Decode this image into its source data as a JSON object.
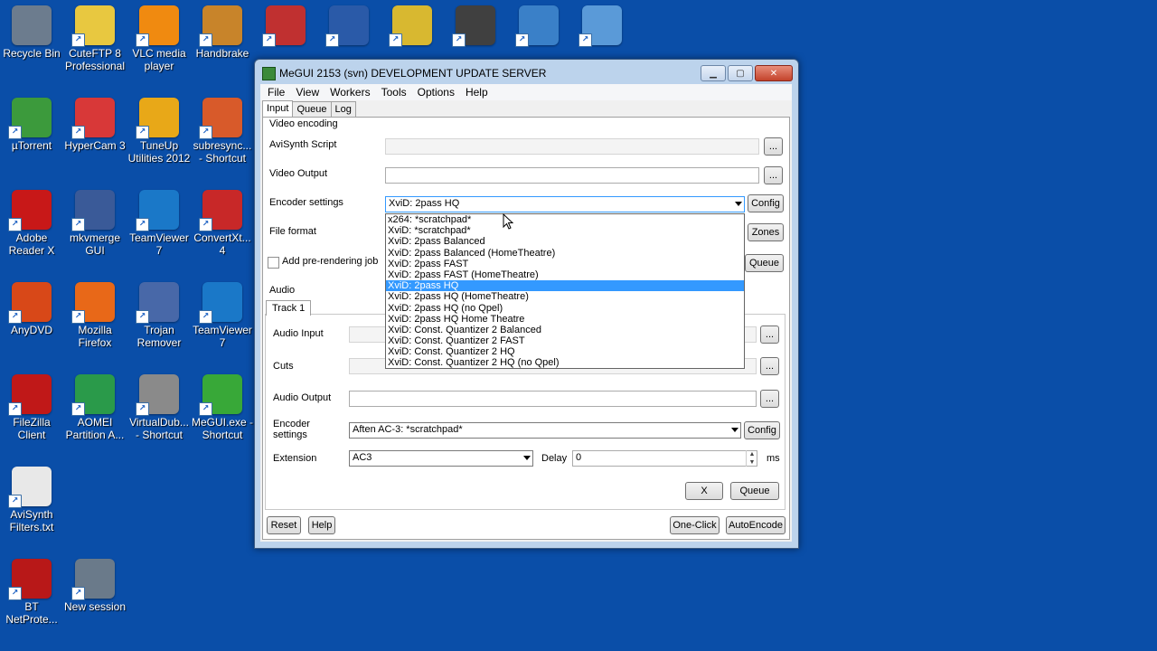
{
  "desktop": {
    "icons": [
      {
        "label": "Recycle Bin",
        "icon": "recycle-bin-icon",
        "color": "#6c7c8e"
      },
      {
        "label": "CuteFTP 8\nProfessional",
        "icon": "cuteftp-icon",
        "color": "#e8c840"
      },
      {
        "label": "VLC media\nplayer",
        "icon": "vlc-icon",
        "color": "#f08a10"
      },
      {
        "label": "Handbrake",
        "icon": "handbrake-icon",
        "color": "#c8842a"
      },
      {
        "label": "",
        "icon": "app-icon",
        "color": "#c03030"
      },
      {
        "label": "",
        "icon": "powershell-icon",
        "color": "#2a5aa8"
      },
      {
        "label": "",
        "icon": "app-icon",
        "color": "#d8b830"
      },
      {
        "label": "",
        "icon": "app-icon",
        "color": "#404040"
      },
      {
        "label": "",
        "icon": "app-icon",
        "color": "#3a80c8"
      },
      {
        "label": "",
        "icon": "app-icon",
        "color": "#5a9ad8"
      },
      {
        "label": "µTorrent",
        "icon": "utorrent-icon",
        "color": "#3c9a3c"
      },
      {
        "label": "HyperCam 3",
        "icon": "hypercam-icon",
        "color": "#d83838"
      },
      {
        "label": "TuneUp\nUtilities 2012",
        "icon": "tuneup-icon",
        "color": "#e8a818"
      },
      {
        "label": "subresync...\n- Shortcut",
        "icon": "subresync-icon",
        "color": "#d85a2a"
      },
      {
        "label": "Adobe\nReader X",
        "icon": "adobe-reader-icon",
        "color": "#c81818"
      },
      {
        "label": "mkvmerge\nGUI",
        "icon": "mkvmerge-icon",
        "color": "#3a5a98"
      },
      {
        "label": "TeamViewer\n7",
        "icon": "teamviewer-icon",
        "color": "#1a78c8"
      },
      {
        "label": "ConvertXt...\n4",
        "icon": "convertx-icon",
        "color": "#c82828"
      },
      {
        "label": "AnyDVD",
        "icon": "anydvd-icon",
        "color": "#d84818"
      },
      {
        "label": "Mozilla\nFirefox",
        "icon": "firefox-icon",
        "color": "#e86818"
      },
      {
        "label": "Trojan\nRemover",
        "icon": "trojan-remover-icon",
        "color": "#4868a8"
      },
      {
        "label": "TeamViewer\n7",
        "icon": "teamviewer-icon",
        "color": "#1a78c8"
      },
      {
        "label": "FileZilla\nClient",
        "icon": "filezilla-icon",
        "color": "#c01818"
      },
      {
        "label": "AOMEI\nPartition A...",
        "icon": "aomei-icon",
        "color": "#2a9a4a"
      },
      {
        "label": "VirtualDub...\n- Shortcut",
        "icon": "virtualdub-icon",
        "color": "#8a8a8a"
      },
      {
        "label": "MeGUI.exe -\nShortcut",
        "icon": "megui-icon",
        "color": "#38a838"
      },
      {
        "label": "AviSynth\nFilters.txt",
        "icon": "text-file-icon",
        "color": "#e8e8e8"
      },
      {
        "label": "BT\nNetProte...",
        "icon": "mcafee-icon",
        "color": "#b81818"
      },
      {
        "label": "New session",
        "icon": "new-session-icon",
        "color": "#6a7a8a"
      }
    ]
  },
  "window": {
    "title": "MeGUI 2153 (svn) DEVELOPMENT UPDATE SERVER",
    "menu": [
      "File",
      "View",
      "Workers",
      "Tools",
      "Options",
      "Help"
    ],
    "tabs": [
      "Input",
      "Queue",
      "Log"
    ]
  },
  "video": {
    "group_label": "Video encoding",
    "avisynth_label": "AviSynth Script",
    "avisynth_value": "",
    "output_label": "Video Output",
    "output_value": "",
    "encoder_label": "Encoder settings",
    "encoder_value": "XviD: 2pass HQ",
    "config_label": "Config",
    "file_format_label": "File format",
    "zones_label": "Zones",
    "prerender_label": "Add pre-rendering job",
    "queue_label": "Queue",
    "browse_label": "..."
  },
  "dropdown_options": [
    "x264: *scratchpad*",
    "XviD: *scratchpad*",
    "XviD: 2pass Balanced",
    "XviD: 2pass Balanced (HomeTheatre)",
    "XviD: 2pass FAST",
    "XviD: 2pass FAST (HomeTheatre)",
    "XviD: 2pass HQ",
    "XviD: 2pass HQ (HomeTheatre)",
    "XviD: 2pass HQ (no Qpel)",
    "XviD: 2pass HQ Home Theatre",
    "XviD: Const. Quantizer 2 Balanced",
    "XviD: Const. Quantizer 2 FAST",
    "XviD: Const. Quantizer 2 HQ",
    "XviD: Const. Quantizer 2 HQ (no Qpel)"
  ],
  "audio": {
    "group_label": "Audio",
    "track_tab": "Track 1",
    "input_label": "Audio Input",
    "cuts_label": "Cuts",
    "output_label": "Audio Output",
    "encoder_label": "Encoder\nsettings",
    "encoder_value": "Aften AC-3: *scratchpad*",
    "config_label": "Config",
    "extension_label": "Extension",
    "extension_value": "AC3",
    "delay_label": "Delay",
    "delay_value": "0",
    "ms_label": "ms",
    "x_label": "X",
    "queue_label": "Queue"
  },
  "bottom": {
    "reset": "Reset",
    "help": "Help",
    "one_click": "One-Click",
    "autoencode": "AutoEncode"
  }
}
